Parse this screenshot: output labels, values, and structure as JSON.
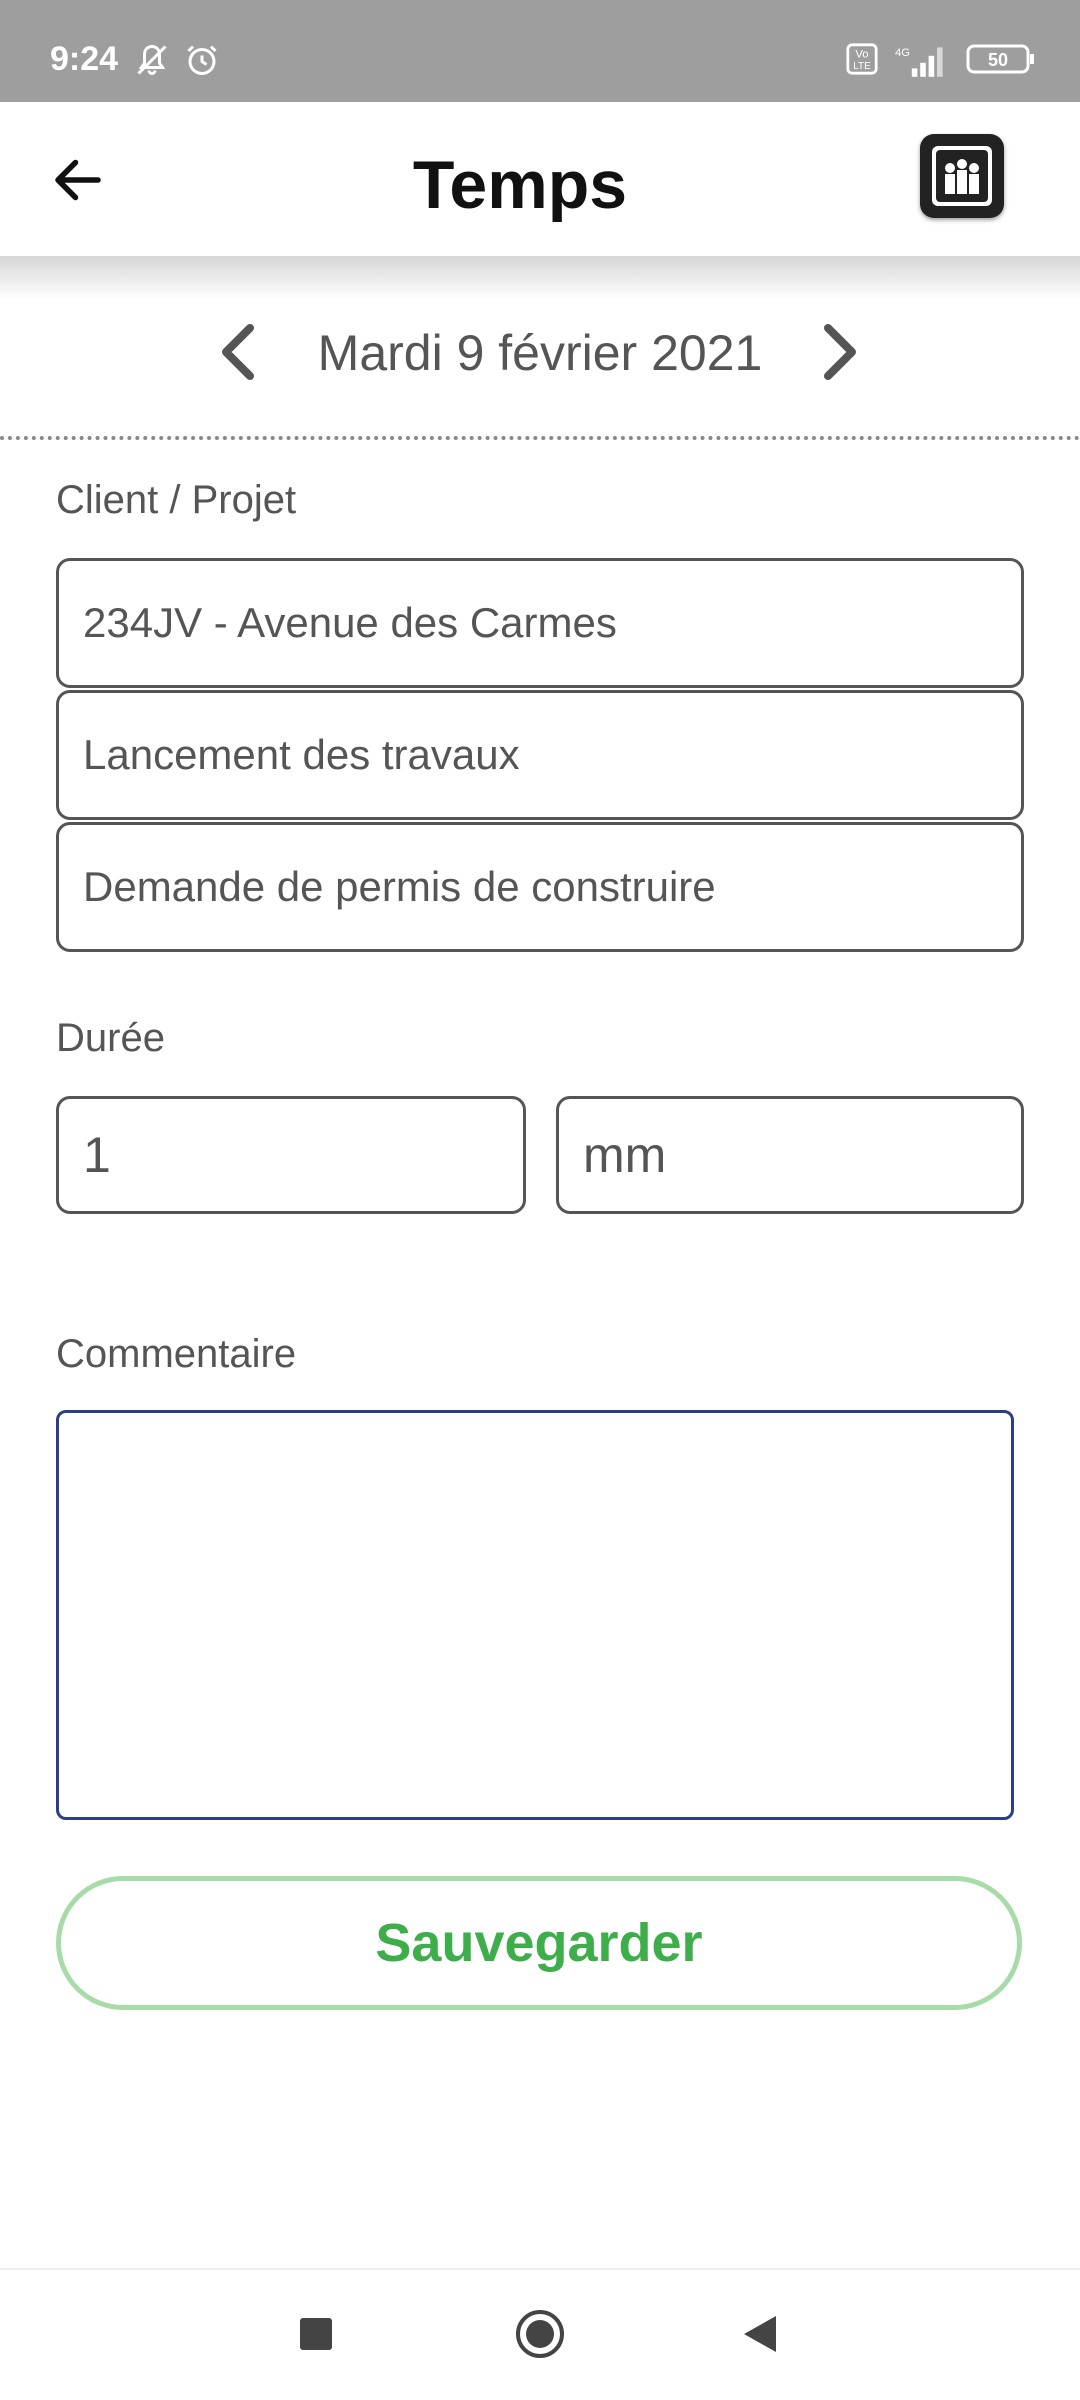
{
  "status_bar": {
    "time": "9:24",
    "icons": [
      "bell-off-icon",
      "alarm-icon",
      "volte-icon",
      "signal-4g-icon",
      "battery-icon"
    ],
    "battery_level": "50"
  },
  "app_bar": {
    "title": "Temps",
    "back_icon": "arrow-left-icon",
    "logo_icon": "app-logo-icon"
  },
  "date_nav": {
    "date": "Mardi 9 février 2021",
    "prev_icon": "chevron-left-icon",
    "next_icon": "chevron-right-icon"
  },
  "form": {
    "client_label": "Client / Projet",
    "client_value": "234JV - Avenue des Carmes",
    "phase_value": "Lancement des travaux",
    "task_value": "Demande de permis de construire",
    "duration_label": "Durée",
    "duration_hours": "1",
    "duration_minutes_placeholder": "mm",
    "comment_label": "Commentaire",
    "comment_value": "",
    "save_label": "Sauvegarder"
  },
  "system_nav": {
    "icons": [
      "recents-square-icon",
      "home-circle-icon",
      "back-triangle-icon"
    ]
  },
  "colors": {
    "status_bar": "#9e9e9e",
    "comment_border": "#2c3e86",
    "save_text": "#3dae49",
    "save_border": "#a8dba8"
  }
}
